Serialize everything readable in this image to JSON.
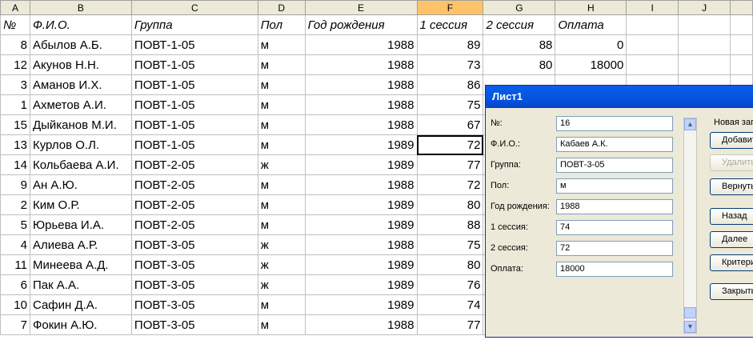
{
  "sheet": {
    "col_letters": [
      "A",
      "B",
      "C",
      "D",
      "E",
      "F",
      "G",
      "H",
      "I",
      "J"
    ],
    "headers": [
      "№",
      "Ф.И.О.",
      "Группа",
      "Пол",
      "Год рождения",
      "1 сессия",
      "2 сессия",
      "Оплата"
    ],
    "rows": [
      [
        "8",
        "Абылов А.Б.",
        "ПОВТ-1-05",
        "м",
        "1988",
        "89",
        "88",
        "0"
      ],
      [
        "12",
        "Акунов Н.Н.",
        "ПОВТ-1-05",
        "м",
        "1988",
        "73",
        "80",
        "18000"
      ],
      [
        "3",
        "Аманов И.Х.",
        "ПОВТ-1-05",
        "м",
        "1988",
        "86",
        "",
        ""
      ],
      [
        "1",
        "Ахметов А.И.",
        "ПОВТ-1-05",
        "м",
        "1988",
        "75",
        "",
        ""
      ],
      [
        "15",
        "Дыйканов М.И.",
        "ПОВТ-1-05",
        "м",
        "1988",
        "67",
        "",
        ""
      ],
      [
        "13",
        "Курлов О.Л.",
        "ПОВТ-1-05",
        "м",
        "1989",
        "72",
        "",
        ""
      ],
      [
        "14",
        "Кольбаева А.И.",
        "ПОВТ-2-05",
        "ж",
        "1989",
        "77",
        "",
        ""
      ],
      [
        "9",
        "Ан А.Ю.",
        "ПОВТ-2-05",
        "м",
        "1988",
        "72",
        "",
        ""
      ],
      [
        "2",
        "Ким О.Р.",
        "ПОВТ-2-05",
        "м",
        "1989",
        "80",
        "",
        ""
      ],
      [
        "5",
        "Юрьева И.А.",
        "ПОВТ-2-05",
        "м",
        "1989",
        "88",
        "",
        ""
      ],
      [
        "4",
        "Алиева А.Р.",
        "ПОВТ-3-05",
        "ж",
        "1988",
        "75",
        "",
        ""
      ],
      [
        "11",
        "Минеева А.Д.",
        "ПОВТ-3-05",
        "ж",
        "1989",
        "80",
        "",
        ""
      ],
      [
        "6",
        "Пак А.А.",
        "ПОВТ-3-05",
        "ж",
        "1989",
        "76",
        "",
        ""
      ],
      [
        "10",
        "Сафин Д.А.",
        "ПОВТ-3-05",
        "м",
        "1989",
        "74",
        "",
        ""
      ],
      [
        "7",
        "Фокин А.Ю.",
        "ПОВТ-3-05",
        "м",
        "1988",
        "77",
        "",
        ""
      ]
    ]
  },
  "dialog": {
    "title": "Лист1",
    "fields": [
      {
        "label": "№:",
        "value": "16"
      },
      {
        "label": "Ф.И.О.:",
        "value": "Кабаев А.К."
      },
      {
        "label": "Группа:",
        "value": "ПОВТ-3-05"
      },
      {
        "label": "Пол:",
        "value": "м"
      },
      {
        "label": "Год рождения:",
        "value": "1988"
      },
      {
        "label": "1 сессия:",
        "value": "74"
      },
      {
        "label": "2 сессия:",
        "value": "72"
      },
      {
        "label": "Оплата:",
        "value": "18000"
      }
    ],
    "record_status": "Новая запись",
    "buttons": {
      "add": "Добавить",
      "delete": "Удалить",
      "restore": "Вернуть",
      "prev": "Назад",
      "next": "Далее",
      "criteria": "Критерии",
      "close": "Закрыть"
    },
    "scroll_up_icon": "arrow-up-icon",
    "scroll_down_icon": "arrow-down-icon"
  },
  "colors": {
    "active_col_header": "#fec368",
    "title_bar": "#0454e0"
  }
}
